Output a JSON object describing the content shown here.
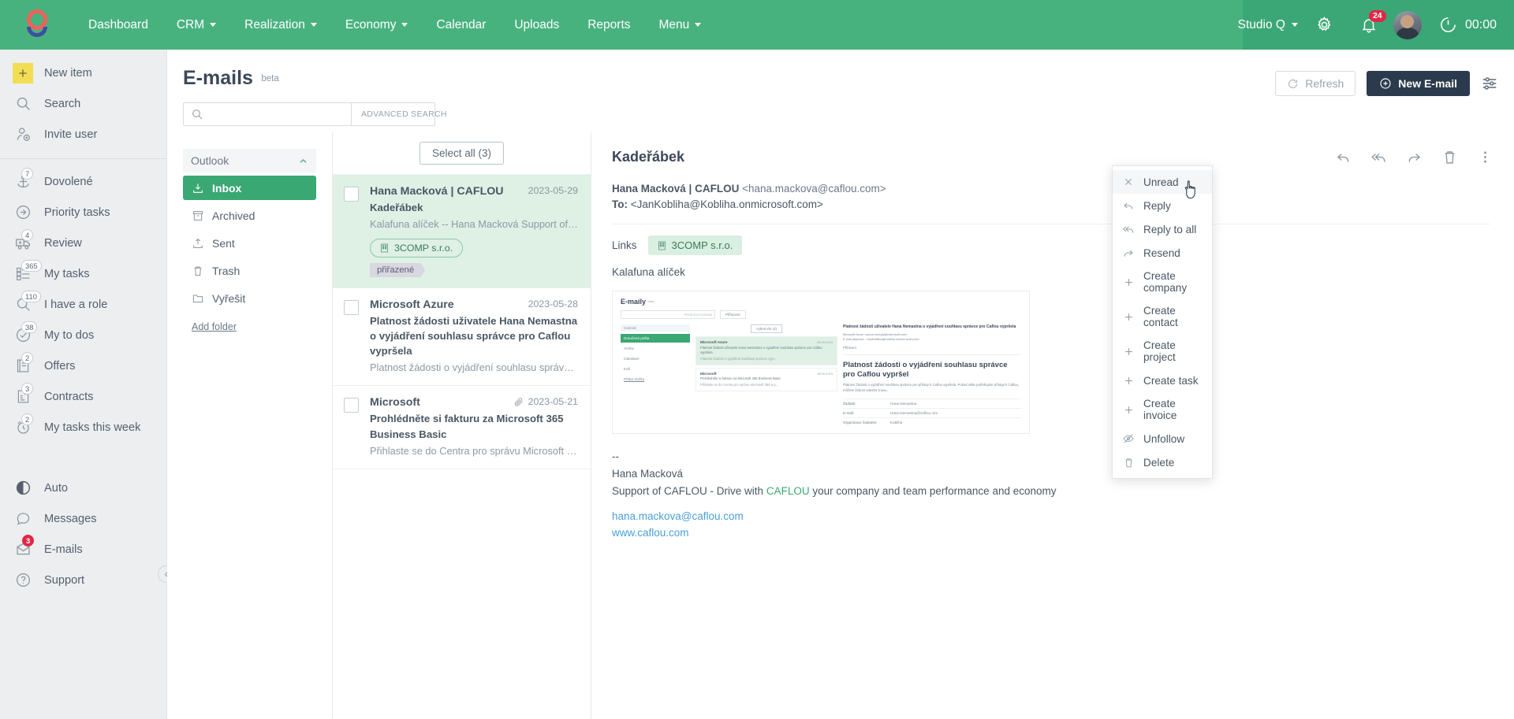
{
  "topnav": {
    "brand_icon": "caflou-logo",
    "items": [
      {
        "label": "Dashboard",
        "has_caret": false
      },
      {
        "label": "CRM",
        "has_caret": true
      },
      {
        "label": "Realization",
        "has_caret": true
      },
      {
        "label": "Economy",
        "has_caret": true
      },
      {
        "label": "Calendar",
        "has_caret": false
      },
      {
        "label": "Uploads",
        "has_caret": false
      },
      {
        "label": "Reports",
        "has_caret": false
      },
      {
        "label": "Menu",
        "has_caret": true
      }
    ],
    "workspace": "Studio Q",
    "notifications_count": "24",
    "timer": "00:00",
    "accent_green": "#48b27f",
    "badge_red": "#e02845"
  },
  "sidebar": {
    "top_items": [
      {
        "label": "New item",
        "icon": "plus-icon",
        "badge": ""
      },
      {
        "label": "Search",
        "icon": "search-icon",
        "badge": ""
      },
      {
        "label": "Invite user",
        "icon": "invite-user-icon",
        "badge": ""
      }
    ],
    "main_items": [
      {
        "label": "Dovolené",
        "icon": "anchor-icon",
        "badge": "7"
      },
      {
        "label": "Priority tasks",
        "icon": "arrow-right-circle-icon",
        "badge": ""
      },
      {
        "label": "Review",
        "icon": "ambulance-icon",
        "badge": "4"
      },
      {
        "label": "My tasks",
        "icon": "checklist-icon",
        "badge": "365"
      },
      {
        "label": "I have a role",
        "icon": "role-search-icon",
        "badge": "110"
      },
      {
        "label": "My to dos",
        "icon": "check-circle-icon",
        "badge": "38"
      },
      {
        "label": "Offers",
        "icon": "offers-icon",
        "badge": "2"
      },
      {
        "label": "Contracts",
        "icon": "contract-icon",
        "badge": "3"
      },
      {
        "label": "My tasks this week",
        "icon": "alarm-clock-icon",
        "badge": "2"
      }
    ],
    "bottom_items": [
      {
        "label": "Auto",
        "icon": "half-circle-icon",
        "badge": ""
      },
      {
        "label": "Messages",
        "icon": "chat-bubble-icon",
        "badge": ""
      },
      {
        "label": "E-mails",
        "icon": "envelope-icon",
        "badge": "3"
      },
      {
        "label": "Support",
        "icon": "question-circle-icon",
        "badge": ""
      }
    ]
  },
  "page": {
    "title": "E-mails",
    "beta_label": "beta",
    "search_value": "",
    "search_placeholder": "",
    "advanced_search_label": "ADVANCED SEARCH",
    "refresh_label": "Refresh",
    "new_email_label": "New E-mail"
  },
  "folders": {
    "account_label": "Outlook",
    "items": [
      {
        "label": "Inbox",
        "icon": "inbox-icon",
        "active": true
      },
      {
        "label": "Archived",
        "icon": "archive-icon",
        "active": false
      },
      {
        "label": "Sent",
        "icon": "sent-icon",
        "active": false
      },
      {
        "label": "Trash",
        "icon": "trash-icon",
        "active": false
      },
      {
        "label": "Vyřešit",
        "icon": "folder-icon",
        "active": false
      }
    ],
    "add_folder_label": "Add folder"
  },
  "mail_list": {
    "select_all_label": "Select all (3)",
    "items": [
      {
        "from": "Hana Macková | CAFLOU",
        "subject": "Kadeřábek",
        "preview": "Kalafuna alíček -- Hana Macková Support of CAFLOU -...",
        "date": "2023-05-29",
        "has_attachment": false,
        "selected": true,
        "company_tag": "3COMP s.r.o.",
        "tag": "přiřazené"
      },
      {
        "from": "Microsoft Azure",
        "subject": "Platnost žádosti uživatele Hana Nemastna o vyjádření souhlasu správce pro Caflou vypršela",
        "preview": "Platnost žádosti o vyjádření souhlasu správce vyprš...",
        "date": "2023-05-28",
        "has_attachment": false,
        "selected": false,
        "company_tag": "",
        "tag": ""
      },
      {
        "from": "Microsoft",
        "subject": "Prohlédněte si fakturu za Microsoft 365 Business Basic",
        "preview": "Přihlaste se do Centra pro správu Microsoft 365 a p...",
        "date": "2023-05-21",
        "has_attachment": true,
        "selected": false,
        "company_tag": "",
        "tag": ""
      }
    ]
  },
  "detail": {
    "title": "Kadeřábek",
    "from_name": "Hana Macková | CAFLOU",
    "from_address": "<hana.mackova@caflou.com>",
    "to_label": "To:",
    "to_address": "<JanKobliha@Kobliha.onmicrosoft.com>",
    "links_label": "Links",
    "link_chip": "3COMP s.r.o.",
    "body_title": "Kalafuna alíček",
    "actions": [
      {
        "name": "reply-icon"
      },
      {
        "name": "reply-all-icon"
      },
      {
        "name": "forward-icon"
      },
      {
        "name": "delete-icon"
      },
      {
        "name": "more-icon"
      }
    ],
    "embedded_shot": {
      "app_title": "E-maily",
      "app_beta": "beta",
      "search_placeholder": "POKROČILÉ HLEDÁNÍ",
      "assign_button": "Přiřazené",
      "folders": [
        "Doručená pošta",
        "Archiv",
        "Odeslané",
        "Koš",
        "Přidat složku"
      ],
      "select_all": "Vybrat vše (2)",
      "mail1_from": "Microsoft Azure",
      "mail1_date": "28.05.2023",
      "mail1_subject": "Platnost žádosti uživatele Hana Nemastna o vyjádření souhlasu správce pro Caflou vypršela",
      "mail1_preview": "Platnost žádosti o vyjádření souhlasu správce vypr...",
      "mail2_from": "Microsoft",
      "mail2_date": "18.05.2023",
      "mail2_subject": "Prohlédněte si fakturu za Microsoft 365 Business Basic",
      "mail2_preview": "Přihlaste se do Centra pro správu Microsoft 365 a p...",
      "detail_title": "Platnost žádosti uživatele Hana Nemastna o vyjádření souhlasu správce pro Caflou vypršela",
      "detail_from": "Microsoft Azure <azure-noreply@microsoft.com>",
      "detail_to": "E-mail příjemce: <JanKobliha@Kobliha.onmicrosoft.com>",
      "detail_tag": "Přiřazení",
      "panel_heading": "Platnost žádosti o vyjádření souhlasu správce pro Caflou vypršel",
      "panel_text": "Platnost žádosti o vyjádření souhlasu správce pro přístup k Caflou vypršela. Pokud stále potřebujete přístup k Caflou, můžete žádost odeslat znovu.",
      "rows": [
        {
          "k": "Žadatel:",
          "v": "Hana Nemastna"
        },
        {
          "k": "E-mail:",
          "v": "Hana.Nemastna@caflou.com"
        },
        {
          "k": "Organizace žadatele:",
          "v": "Kobliha"
        }
      ]
    },
    "signature": {
      "dashes": "--",
      "name": "Hana Macková",
      "line": "Support of CAFLOU - Drive with CAFLOU your company and team performance and economy",
      "brand": "CAFLOU",
      "email": "hana.mackova@caflou.com",
      "web": "www.caflou.com"
    }
  },
  "context_menu": {
    "items": [
      {
        "label": "Unread",
        "icon": "close-x-icon",
        "hover": true
      },
      {
        "label": "Reply",
        "icon": "reply-icon",
        "hover": false
      },
      {
        "label": "Reply to all",
        "icon": "reply-all-icon",
        "hover": false
      },
      {
        "label": "Resend",
        "icon": "forward-icon",
        "hover": false
      },
      {
        "label": "Create company",
        "icon": "plus-icon",
        "hover": false
      },
      {
        "label": "Create contact",
        "icon": "plus-icon",
        "hover": false
      },
      {
        "label": "Create project",
        "icon": "plus-icon",
        "hover": false
      },
      {
        "label": "Create task",
        "icon": "plus-icon",
        "hover": false
      },
      {
        "label": "Create invoice",
        "icon": "plus-icon",
        "hover": false
      },
      {
        "label": "Unfollow",
        "icon": "eye-off-icon",
        "hover": false
      },
      {
        "label": "Delete",
        "icon": "trash-icon",
        "hover": false
      }
    ]
  }
}
